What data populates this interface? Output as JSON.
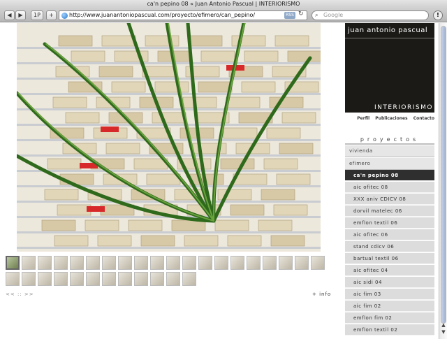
{
  "window": {
    "title": "ca'n pepino 08 « Juan Antonio Pascual | INTERIORISMO"
  },
  "toolbar": {
    "back_icon": "back-arrow-icon",
    "forward_icon": "forward-arrow-icon",
    "tabs_label": "1P",
    "add_label": "+",
    "url": "http://www.juanantoniopascual.com/proyecto/efimero/can_pepino/",
    "rss_label": "RSS",
    "reload_icon": "reload-icon",
    "search_placeholder": "Google",
    "stop_icon": "activity-icon"
  },
  "gallery": {
    "thumb_count": 32,
    "active_index": 0,
    "nav_text": "<< :: >>",
    "info_label": "+ info"
  },
  "brand": {
    "name": "juan antonio pascual",
    "subtitle": "INTERIORISMO"
  },
  "topnav": {
    "items": [
      "Perfil",
      "Publicaciones",
      "Contacto"
    ]
  },
  "sidebar": {
    "section_title": "proyectos",
    "categories": [
      "vivienda",
      "efimero"
    ],
    "items": [
      "ca'n pepino 08",
      "aic ofitec 08",
      "XXX aniv CDICV 08",
      "dorvil matelec 06",
      "emflon textil 06",
      "aic ofitec 06",
      "stand cdicv 06",
      "bartual textil 06",
      "aic ofitec 04",
      "aic sidi 04",
      "aic fim 03",
      "aic fim 02",
      "emflon fim 02",
      "emflon textil 02"
    ],
    "selected_index": 0
  },
  "colors": {
    "selected_bg": "#2f2f2f",
    "item_bg": "#dcdcdc",
    "logo_bg": "#1b1a17"
  }
}
